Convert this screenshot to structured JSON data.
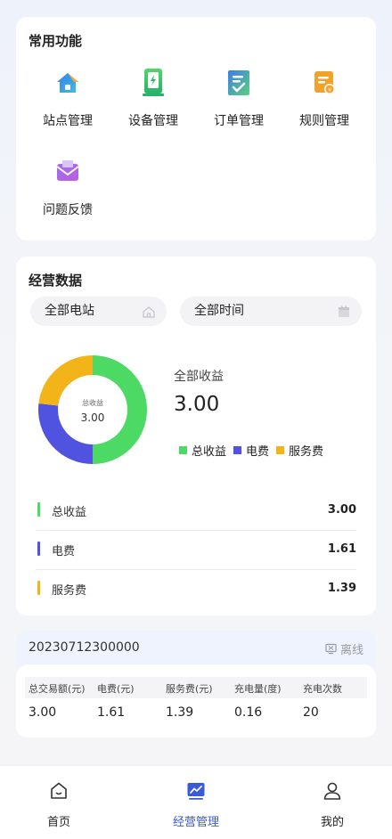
{
  "common_functions": {
    "title": "常用功能",
    "items": [
      {
        "label": "站点管理",
        "icon": "station-icon"
      },
      {
        "label": "设备管理",
        "icon": "charger-icon"
      },
      {
        "label": "订单管理",
        "icon": "order-icon"
      },
      {
        "label": "规则管理",
        "icon": "rule-icon"
      },
      {
        "label": "问题反馈",
        "icon": "feedback-icon"
      }
    ]
  },
  "business_data": {
    "title": "经营数据",
    "station_filter": "全部电站",
    "time_filter": "全部时间",
    "donut_center_label": "总收益",
    "donut_center_value": "3.00",
    "summary_label": "全部收益",
    "summary_value": "3.00",
    "legend": [
      {
        "name": "总收益",
        "color": "#4cd964"
      },
      {
        "name": "电费",
        "color": "#5052e0"
      },
      {
        "name": "服务费",
        "color": "#f2b418"
      }
    ],
    "rows": [
      {
        "name": "总收益",
        "value": "3.00",
        "color": "#4cd964"
      },
      {
        "name": "电费",
        "value": "1.61",
        "color": "#5052e0"
      },
      {
        "name": "服务费",
        "value": "1.39",
        "color": "#f2b418"
      }
    ]
  },
  "chart_data": {
    "type": "pie",
    "categories": [
      "总收益",
      "电费",
      "服务费"
    ],
    "values": [
      3.0,
      1.61,
      1.39
    ],
    "colors": [
      "#4cd964",
      "#5052e0",
      "#f2b418"
    ],
    "title": "",
    "center_label": "总收益",
    "center_value": "3.00",
    "legend_position": "bottom"
  },
  "device": {
    "id": "20230712300000",
    "status": "离线",
    "columns": [
      "总交易额(元)",
      "电费(元)",
      "服务费(元)",
      "充电量(度)",
      "充电次数"
    ],
    "values": [
      "3.00",
      "1.61",
      "1.39",
      "0.16",
      "20"
    ]
  },
  "tabbar": {
    "tabs": [
      {
        "label": "首页",
        "icon": "home-icon"
      },
      {
        "label": "经营管理",
        "icon": "business-chart-icon"
      },
      {
        "label": "我的",
        "icon": "profile-icon"
      }
    ],
    "active_index": 1,
    "active_color": "#3a5ad6"
  }
}
